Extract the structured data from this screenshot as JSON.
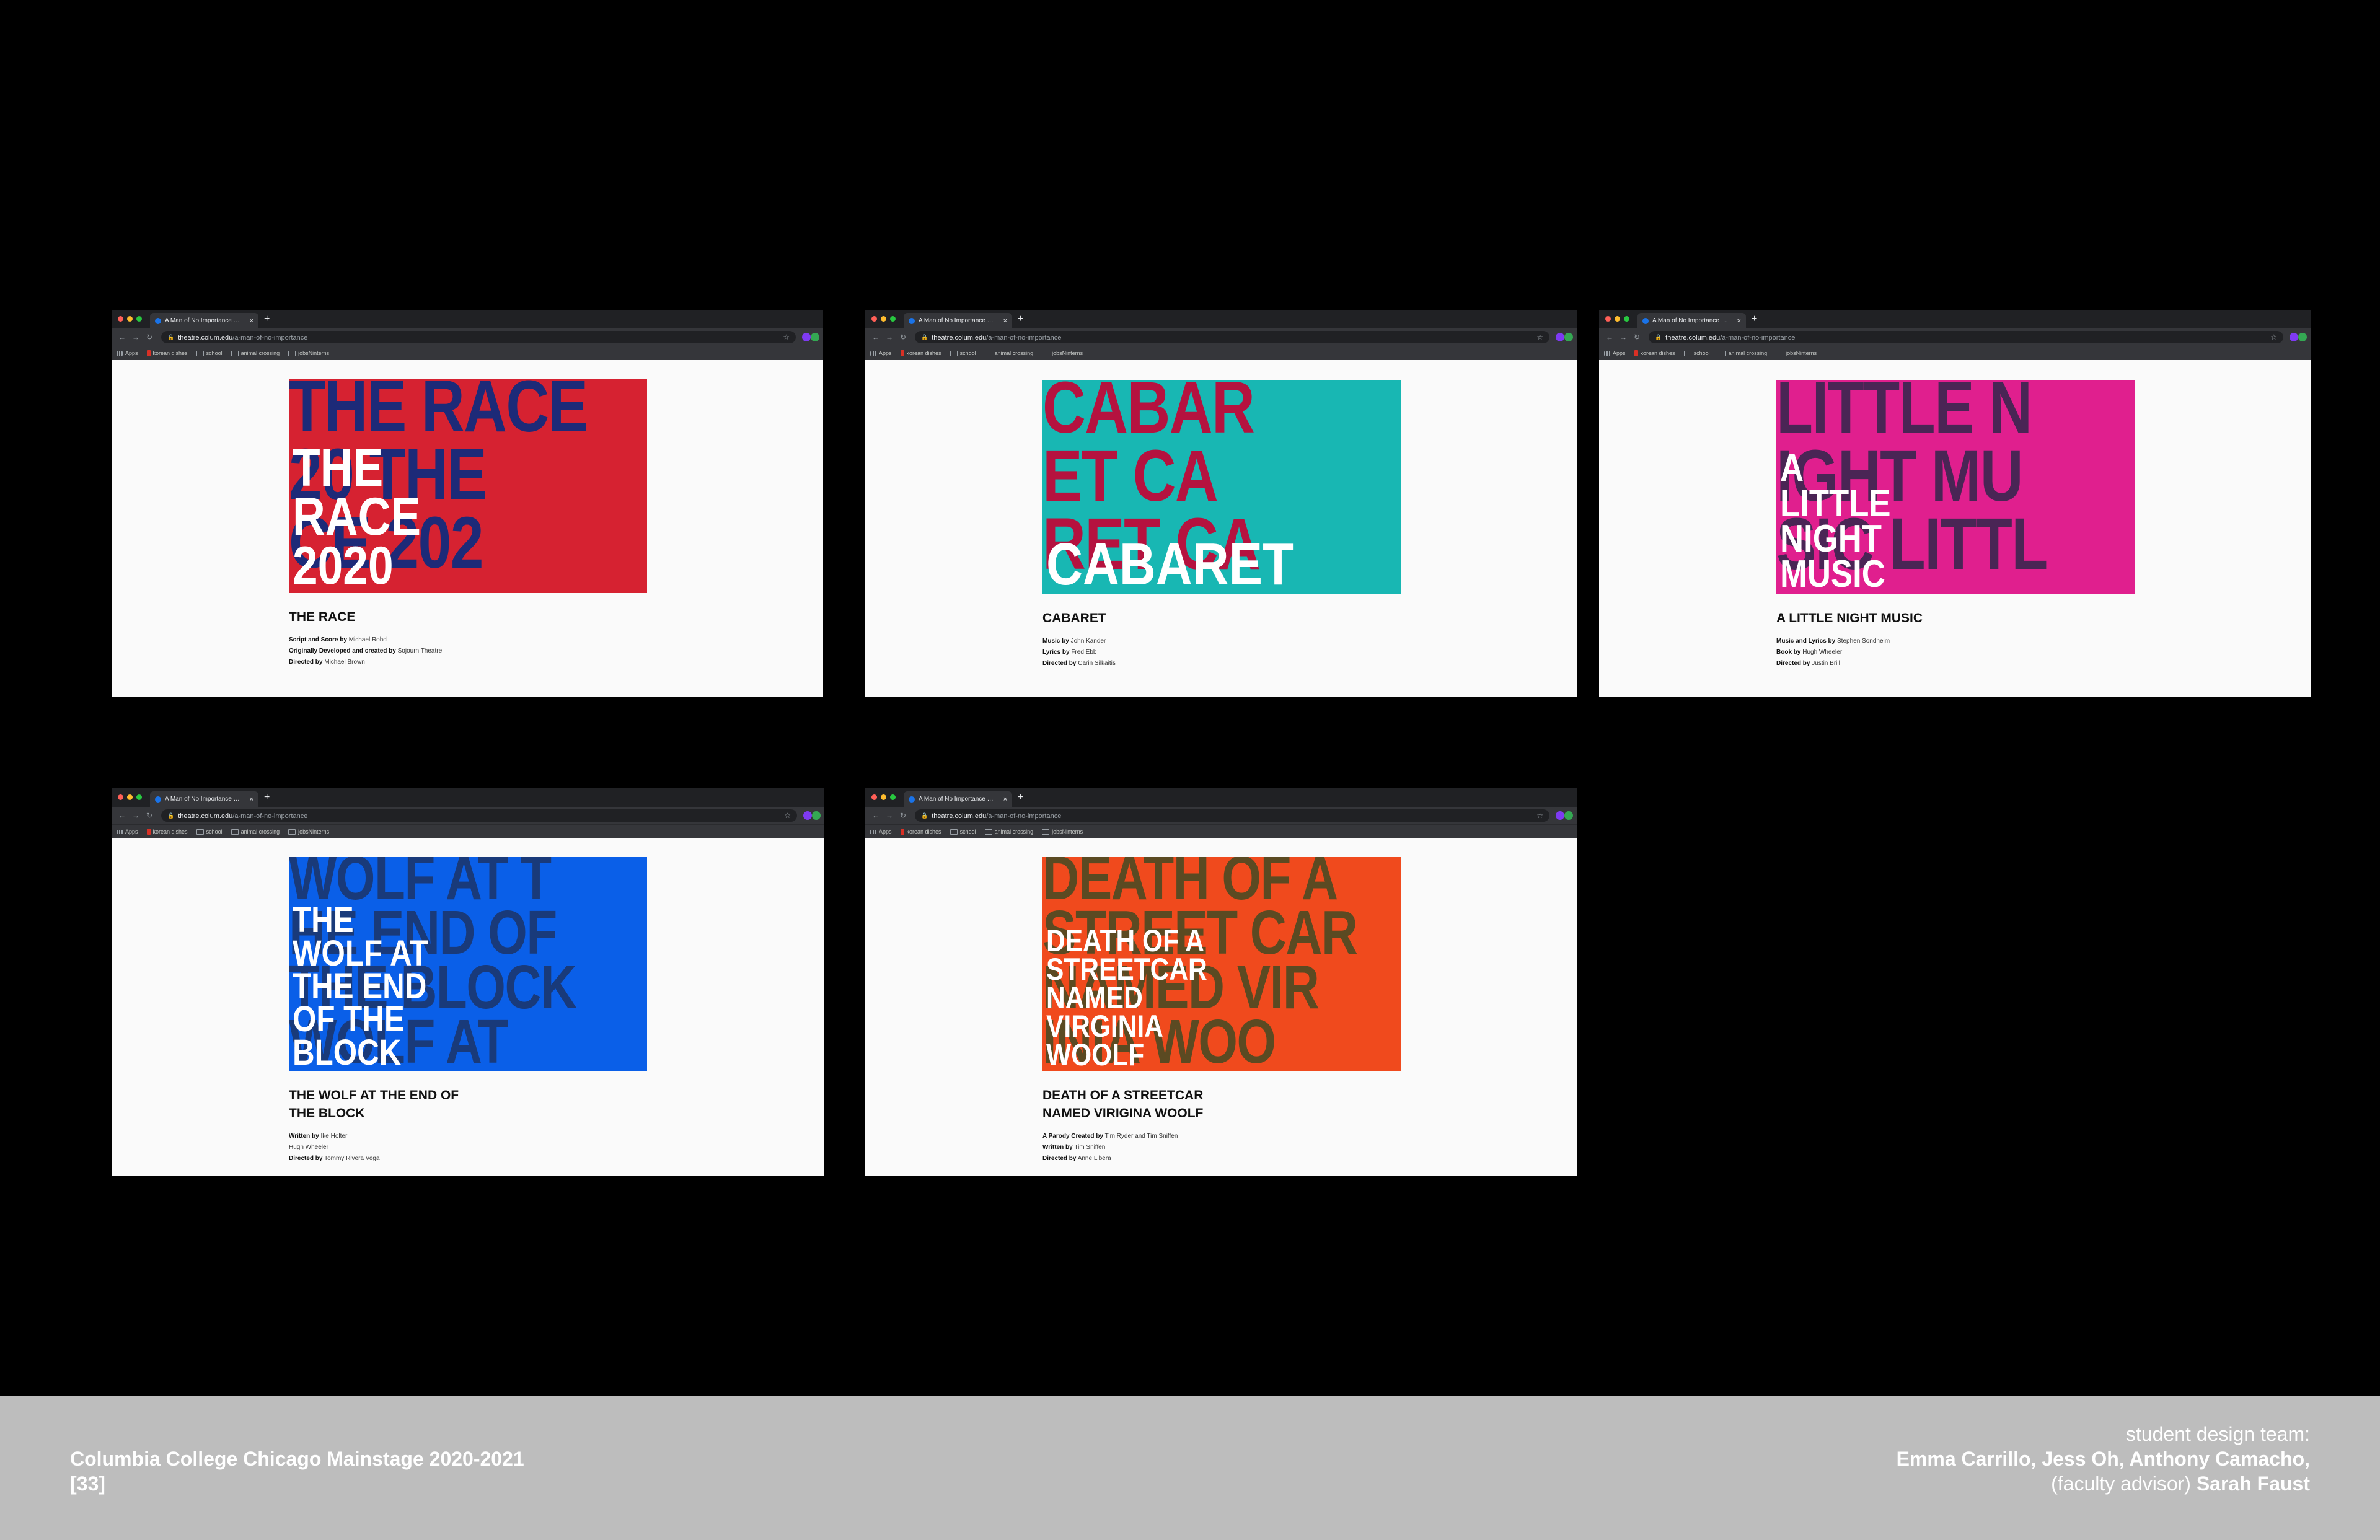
{
  "browser": {
    "tab_title": "A Man of No Importance — Co",
    "url_host": "theatre.colum.edu",
    "url_path": "/a-man-of-no-importance",
    "bookmarks": [
      "Apps",
      "korean dishes",
      "school",
      "animal crossing",
      "jobsNinterns"
    ]
  },
  "windows": [
    {
      "poster": {
        "bg_color": "#d62231",
        "text_color": "#1d2a78",
        "bg_lines": [
          "THE RACE",
          "20 THE",
          "CE 202"
        ],
        "title_lines": [
          "THE",
          "RACE",
          "2020"
        ]
      },
      "title_lines": [
        "THE RACE"
      ],
      "credits": [
        {
          "role": "Script and Score by",
          "name": "Michael Rohd"
        },
        {
          "role": "Originally Developed and created by",
          "name": "Sojourn Theatre"
        },
        {
          "role": "Directed by",
          "name": "Michael Brown"
        }
      ]
    },
    {
      "poster": {
        "bg_color": "#18b7b3",
        "text_color": "#b5123f",
        "bg_lines": [
          "CABAR",
          "ET CA",
          "RET CA"
        ],
        "title_lines": [
          "CABARET"
        ]
      },
      "title_lines": [
        "CABARET"
      ],
      "credits": [
        {
          "role": "Music by",
          "name": "John Kander"
        },
        {
          "role": "Lyrics by",
          "name": "Fred Ebb"
        },
        {
          "role": "Directed by",
          "name": "Carin Silkaitis"
        }
      ]
    },
    {
      "poster": {
        "bg_color": "#e01f8e",
        "text_color": "#4a2555",
        "bg_lines": [
          "LITTLE N",
          "IGHT MU",
          "SIC LITTL"
        ],
        "title_lines": [
          "A",
          "LITTLE",
          "NIGHT",
          "MUSIC"
        ]
      },
      "title_lines": [
        "A LITTLE NIGHT MUSIC"
      ],
      "credits": [
        {
          "role": "Music and Lyrics by",
          "name": "Stephen Sondheim"
        },
        {
          "role": "Book by",
          "name": "Hugh Wheeler"
        },
        {
          "role": "Directed by",
          "name": "Justin Brill"
        }
      ]
    },
    {
      "poster": {
        "bg_color": "#0a5fe8",
        "text_color": "#193a7a",
        "bg_lines": [
          "WOLF AT T",
          "HE END OF",
          "THE BLOCK",
          "WOLF AT"
        ],
        "title_lines": [
          "THE",
          "WOLF AT",
          "THE END",
          "OF THE",
          "BLOCK"
        ]
      },
      "title_lines": [
        "THE WOLF AT THE END OF",
        "THE BLOCK"
      ],
      "credits": [
        {
          "role": "Written by",
          "name": "Ike Holter"
        },
        {
          "role": "",
          "name": "Hugh Wheeler"
        },
        {
          "role": "Directed by",
          "name": "Tommy Rivera Vega"
        }
      ]
    },
    {
      "poster": {
        "bg_color": "#f04a1d",
        "text_color": "#5b4a22",
        "bg_lines": [
          "DEATH OF A",
          "STREET CAR",
          "NAMED VIR",
          "INIA WOO"
        ],
        "title_lines": [
          "DEATH OF A",
          "STREETCAR",
          "NAMED",
          "VIRGINIA",
          "WOOLF"
        ]
      },
      "title_lines": [
        "DEATH OF A STREETCAR",
        "NAMED VIRIGINA WOOLF"
      ],
      "credits": [
        {
          "role": "A Parody Created by",
          "name": "Tim Ryder and Tim Sniffen"
        },
        {
          "role": "Written by",
          "name": "Tim Sniffen"
        },
        {
          "role": "Directed by",
          "name": "Anne Libera"
        }
      ]
    }
  ],
  "footer": {
    "project": "Columbia College Chicago Mainstage 2020-2021",
    "page_number": "[33]",
    "team_label": "student design team:",
    "team_members": "Emma Carrillo, Jess Oh, Anthony Camacho,",
    "advisor_label": "(faculty advisor)",
    "advisor_name": "Sarah Faust"
  }
}
